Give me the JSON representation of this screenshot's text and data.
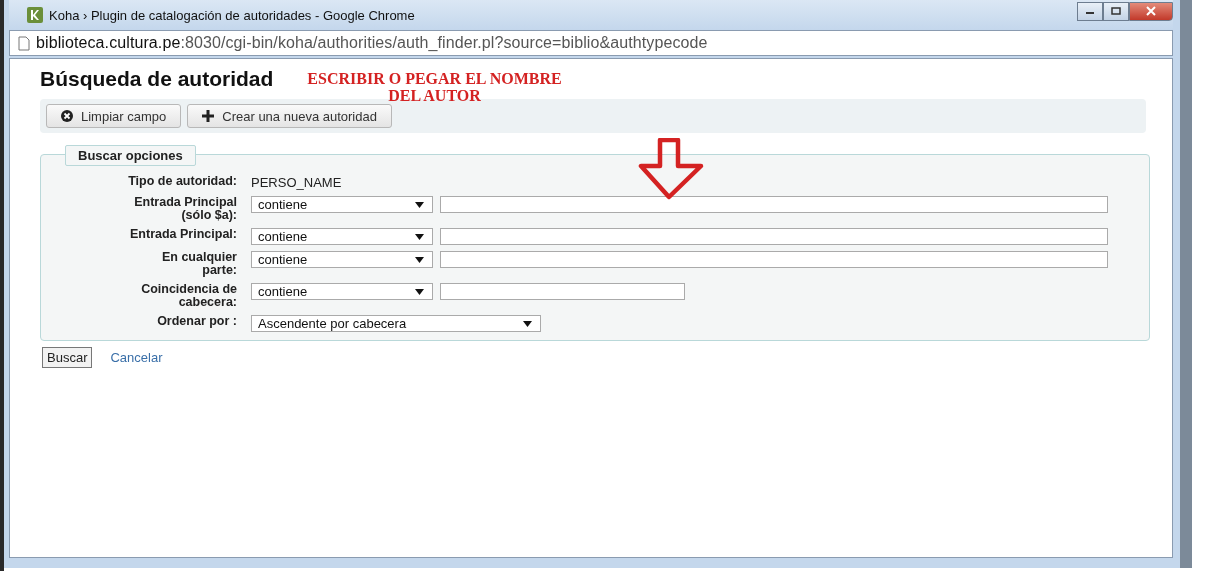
{
  "window": {
    "title": "Koha › Plugin de catalogación de autoridades - Google Chrome",
    "address_host": "biblioteca.cultura.pe",
    "address_path": ":8030/cgi-bin/koha/authorities/auth_finder.pl?source=biblio&authtypecode"
  },
  "page": {
    "title": "Búsqueda de autoridad"
  },
  "annotation": {
    "lines": [
      "ESCRIBIR O PEGAR EL NOMBRE",
      "DEL AUTOR"
    ]
  },
  "toolbar": [
    {
      "label": "Limpiar campo",
      "kind": "clear"
    },
    {
      "label": "Crear una nueva autoridad",
      "kind": "add"
    }
  ],
  "search_options": {
    "legend": "Buscar opciones",
    "type_label": "Tipo de autoridad:",
    "type_value": "PERSO_NAME",
    "rows": [
      {
        "label_lines": [
          "Entrada Principal",
          "(sólo $a):"
        ],
        "operator": "contiene",
        "kind": "wide"
      },
      {
        "label_lines": [
          "Entrada Principal:"
        ],
        "operator": "contiene",
        "kind": "wide"
      },
      {
        "label_lines": [
          "En cualquier",
          "parte:"
        ],
        "operator": "contiene",
        "kind": "wide"
      },
      {
        "label_lines": [
          "Coincidencia de",
          "cabecera:"
        ],
        "operator": "contiene",
        "kind": "narrow"
      }
    ],
    "sort_label": "Ordenar por :",
    "sort_value": "Ascendente por cabecera"
  },
  "actions": {
    "submit": "Buscar",
    "cancel": "Cancelar"
  }
}
